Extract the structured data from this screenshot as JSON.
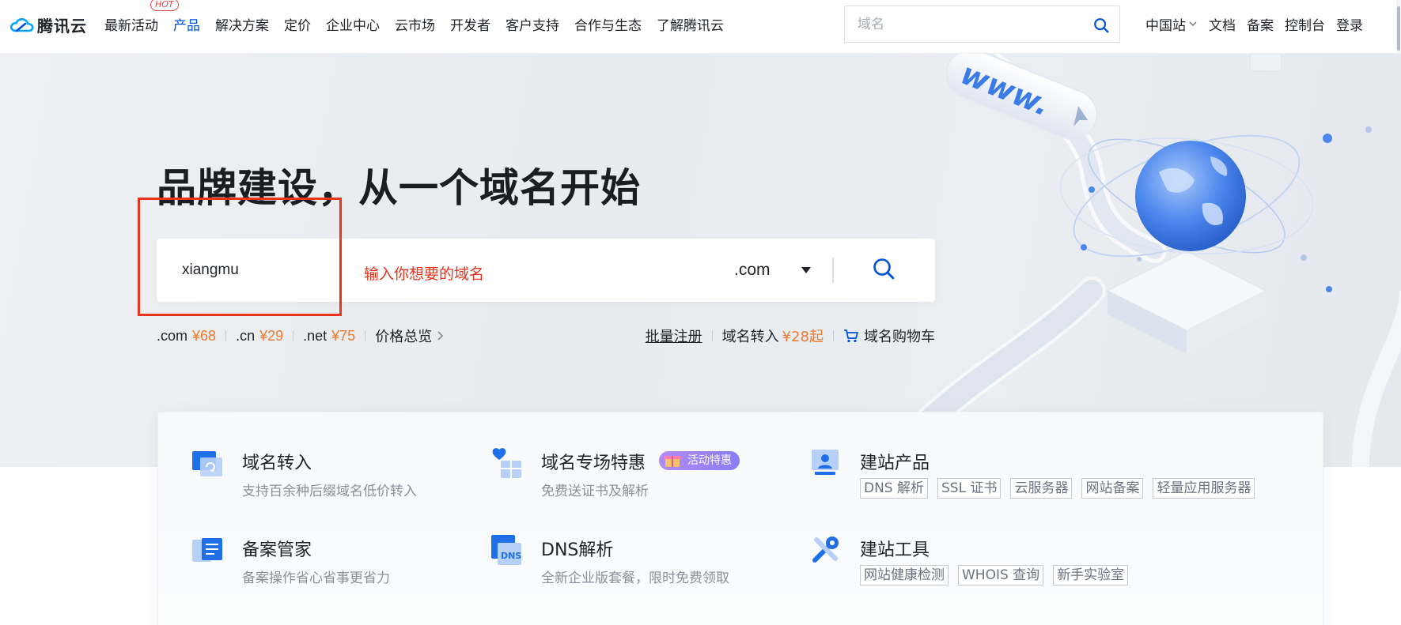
{
  "header": {
    "logo_text": "腾讯云",
    "nav": [
      {
        "label": "最新活动",
        "badge": "HOT"
      },
      {
        "label": "产品",
        "active": true
      },
      {
        "label": "解决方案"
      },
      {
        "label": "定价"
      },
      {
        "label": "企业中心"
      },
      {
        "label": "云市场"
      },
      {
        "label": "开发者"
      },
      {
        "label": "客户支持"
      },
      {
        "label": "合作与生态"
      },
      {
        "label": "了解腾讯云"
      }
    ],
    "search": {
      "placeholder": "域名"
    },
    "right_nav": [
      "中国站",
      "文档",
      "备案",
      "控制台",
      "登录"
    ]
  },
  "hero": {
    "title": "品牌建设，从一个域名开始",
    "domain_input_value": "xiangmu",
    "annotation_text": "输入你想要的域名",
    "tld_selected": ".com",
    "prices": [
      {
        "tld": ".com",
        "price": "¥68"
      },
      {
        "tld": ".cn",
        "price": "¥29"
      },
      {
        "tld": ".net",
        "price": "¥75"
      }
    ],
    "price_overview": "价格总览",
    "bulk_register": "批量注册",
    "transfer_label": "域名转入",
    "transfer_price": "¥28起",
    "cart_label": "域名购物车"
  },
  "services": [
    {
      "title": "域名转入",
      "desc": "支持百余种后缀域名低价转入",
      "icon": "domain-transfer-icon"
    },
    {
      "title": "域名专场特惠",
      "desc": "免费送证书及解析",
      "badge": "活动特惠",
      "icon": "gift-icon"
    },
    {
      "title": "建站产品",
      "tags": [
        "DNS 解析",
        "SSL 证书",
        "云服务器",
        "网站备案",
        "轻量应用服务器"
      ],
      "icon": "site-product-icon"
    },
    {
      "title": "备案管家",
      "desc": "备案操作省心省事更省力",
      "icon": "filing-icon"
    },
    {
      "title": "DNS解析",
      "desc": "全新企业版套餐，限时免费领取",
      "icon": "dns-icon"
    },
    {
      "title": "建站工具",
      "tags": [
        "网站健康检测",
        "WHOIS 查询",
        "新手实验室"
      ],
      "icon": "tools-icon"
    }
  ],
  "colors": {
    "brand_blue": "#0052d9",
    "price_orange": "#ed7b2f",
    "annotation_red": "#e8341c",
    "promo_purple": "#8a7cf5"
  }
}
